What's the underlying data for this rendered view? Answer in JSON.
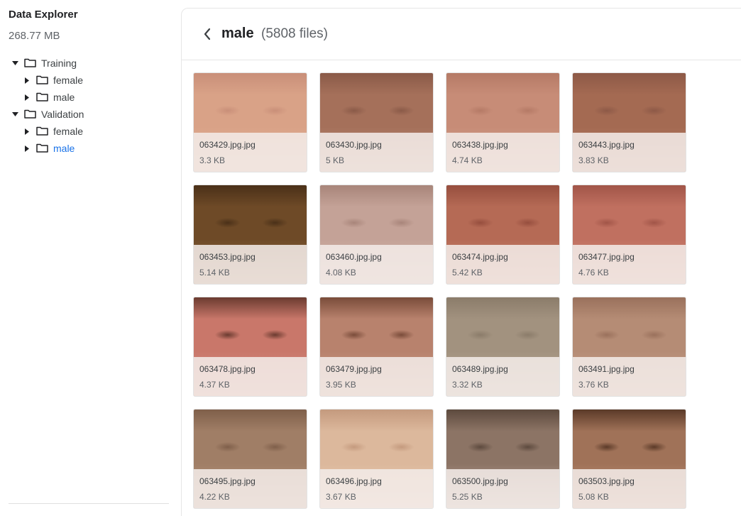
{
  "sidebar": {
    "title": "Data Explorer",
    "size": "268.77 MB",
    "tree": [
      {
        "label": "Training",
        "level": 0,
        "expanded": true,
        "active": false
      },
      {
        "label": "female",
        "level": 1,
        "expanded": false,
        "active": false
      },
      {
        "label": "male",
        "level": 1,
        "expanded": false,
        "active": false
      },
      {
        "label": "Validation",
        "level": 0,
        "expanded": true,
        "active": false
      },
      {
        "label": "female",
        "level": 1,
        "expanded": false,
        "active": false
      },
      {
        "label": "male",
        "level": 1,
        "expanded": false,
        "active": true
      }
    ]
  },
  "header": {
    "title": "male",
    "count": "(5808 files)"
  },
  "files": [
    {
      "name": "063429.jpg.jpg",
      "size": "3.3 KB",
      "colors": [
        "#d9a287",
        "#c98f79",
        "#e2b7a0"
      ]
    },
    {
      "name": "063430.jpg.jpg",
      "size": "5 KB",
      "colors": [
        "#a5705a",
        "#8a5a48",
        "#c9a08a"
      ]
    },
    {
      "name": "063438.jpg.jpg",
      "size": "4.74 KB",
      "colors": [
        "#c78c77",
        "#b57a66",
        "#d9ac98"
      ]
    },
    {
      "name": "063443.jpg.jpg",
      "size": "3.83 KB",
      "colors": [
        "#a46a52",
        "#8d5947",
        "#c08a74"
      ]
    },
    {
      "name": "063453.jpg.jpg",
      "size": "5.14 KB",
      "colors": [
        "#6e4a27",
        "#4a3018",
        "#a07a55"
      ]
    },
    {
      "name": "063460.jpg.jpg",
      "size": "4.08 KB",
      "colors": [
        "#c4a297",
        "#a8857a",
        "#d8bcb2"
      ]
    },
    {
      "name": "063474.jpg.jpg",
      "size": "5.42 KB",
      "colors": [
        "#b56a55",
        "#964e3e",
        "#d39780"
      ]
    },
    {
      "name": "063477.jpg.jpg",
      "size": "4.76 KB",
      "colors": [
        "#c07060",
        "#a15548",
        "#d89d8a"
      ]
    },
    {
      "name": "063478.jpg.jpg",
      "size": "4.37 KB",
      "colors": [
        "#c9776a",
        "#6b3b30",
        "#d99a8c"
      ]
    },
    {
      "name": "063479.jpg.jpg",
      "size": "3.95 KB",
      "colors": [
        "#b8826d",
        "#7a4c3a",
        "#d1a68f"
      ]
    },
    {
      "name": "063489.jpg.jpg",
      "size": "3.32 KB",
      "colors": [
        "#a2927f",
        "#8b7c6a",
        "#c0b2a0"
      ]
    },
    {
      "name": "063491.jpg.jpg",
      "size": "3.76 KB",
      "colors": [
        "#b58c75",
        "#9a715c",
        "#cfaa95"
      ]
    },
    {
      "name": "063495.jpg.jpg",
      "size": "4.22 KB",
      "colors": [
        "#a07e66",
        "#7f5f4a",
        "#c0a089"
      ]
    },
    {
      "name": "063496.jpg.jpg",
      "size": "3.67 KB",
      "colors": [
        "#dcb89c",
        "#c49a7e",
        "#ebd0bb"
      ]
    },
    {
      "name": "063500.jpg.jpg",
      "size": "5.25 KB",
      "colors": [
        "#8c7465",
        "#5d4a3e",
        "#c4b4a8"
      ]
    },
    {
      "name": "063503.jpg.jpg",
      "size": "5.08 KB",
      "colors": [
        "#a07258",
        "#5b3a28",
        "#c99d85"
      ]
    }
  ],
  "icons": {
    "back": "chevron-left-icon",
    "folder": "folder-icon",
    "caret_down": "caret-down-icon",
    "caret_right": "caret-right-icon"
  },
  "colors": {
    "active_link": "#1a73e8",
    "meta_overlay": "#f3ebe7"
  }
}
